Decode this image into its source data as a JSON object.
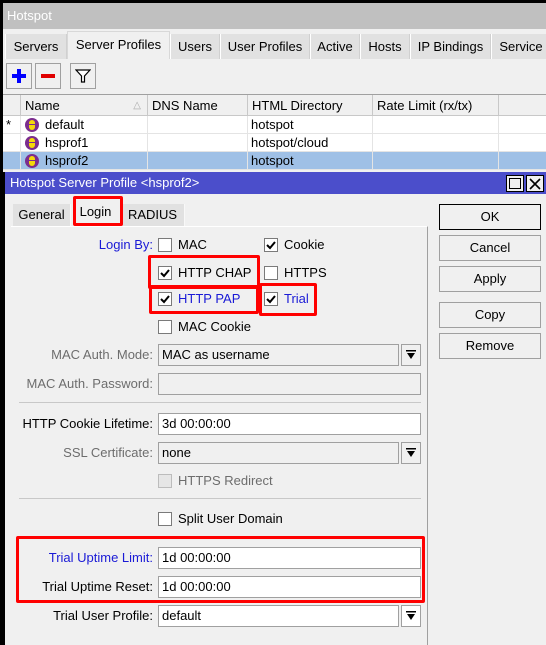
{
  "window": {
    "title": "Hotspot",
    "tabs": [
      {
        "label": "Servers",
        "active": false
      },
      {
        "label": "Server Profiles",
        "active": true
      },
      {
        "label": "Users",
        "active": false
      },
      {
        "label": "User Profiles",
        "active": false
      },
      {
        "label": "Active",
        "active": false
      },
      {
        "label": "Hosts",
        "active": false
      },
      {
        "label": "IP Bindings",
        "active": false
      },
      {
        "label": "Service",
        "active": false
      }
    ],
    "toolbar": {
      "add_icon": "plus-icon",
      "remove_icon": "minus-icon",
      "filter_icon": "filter-icon",
      "add_color": "#0000ff",
      "remove_color": "#e00000"
    }
  },
  "table": {
    "columns": [
      "Name",
      "DNS Name",
      "HTML Directory",
      "Rate Limit (rx/tx)"
    ],
    "sort_column": "Name",
    "rows": [
      {
        "flag": "*",
        "name": "default",
        "dns_name": "",
        "html_directory": "hotspot",
        "rate_limit": "",
        "selected": false
      },
      {
        "flag": "",
        "name": "hsprof1",
        "dns_name": "",
        "html_directory": "hotspot/cloud",
        "rate_limit": "",
        "selected": false
      },
      {
        "flag": "",
        "name": "hsprof2",
        "dns_name": "",
        "html_directory": "hotspot",
        "rate_limit": "",
        "selected": true
      }
    ]
  },
  "dialog": {
    "title": "Hotspot Server Profile <hsprof2>",
    "title_color": "#4b4ecb",
    "tabs": [
      {
        "label": "General",
        "active": false
      },
      {
        "label": "Login",
        "active": true
      },
      {
        "label": "RADIUS",
        "active": false
      }
    ],
    "login_by": {
      "label": "Login By:",
      "options": {
        "mac": {
          "label": "MAC",
          "checked": false
        },
        "cookie": {
          "label": "Cookie",
          "checked": true
        },
        "http_chap": {
          "label": "HTTP CHAP",
          "checked": true
        },
        "https": {
          "label": "HTTPS",
          "checked": false
        },
        "http_pap": {
          "label": "HTTP PAP",
          "checked": true
        },
        "trial": {
          "label": "Trial",
          "checked": true
        },
        "mac_cookie": {
          "label": "MAC Cookie",
          "checked": false
        }
      }
    },
    "mac_auth_mode": {
      "label": "MAC Auth. Mode:",
      "value": "MAC as username"
    },
    "mac_auth_password": {
      "label": "MAC Auth. Password:",
      "value": ""
    },
    "http_cookie_lifetime": {
      "label": "HTTP Cookie Lifetime:",
      "value": "3d 00:00:00"
    },
    "ssl_certificate": {
      "label": "SSL Certificate:",
      "value": "none"
    },
    "https_redirect": {
      "label": "HTTPS Redirect",
      "checked": false,
      "disabled": true
    },
    "split_user_domain": {
      "label": "Split User Domain",
      "checked": false
    },
    "trial_uptime_limit": {
      "label": "Trial Uptime Limit:",
      "value": "1d 00:00:00"
    },
    "trial_uptime_reset": {
      "label": "Trial Uptime Reset:",
      "value": "1d 00:00:00"
    },
    "trial_user_profile": {
      "label": "Trial User Profile:",
      "value": "default"
    },
    "buttons": {
      "ok": "OK",
      "cancel": "Cancel",
      "apply": "Apply",
      "copy": "Copy",
      "remove": "Remove"
    },
    "highlight_color": "#ff0000"
  }
}
